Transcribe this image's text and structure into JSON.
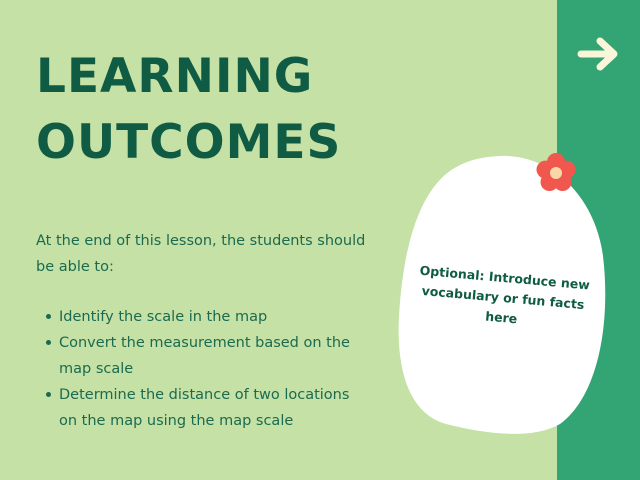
{
  "slide": {
    "title_line1": "LEARNING",
    "title_line2": "OUTCOMES",
    "intro": "At the end of this lesson, the students should be able to:",
    "outcomes": [
      "Identify the scale in the map",
      "Convert the measurement based on the map scale",
      "Determine the distance of two locations on the map using the map scale"
    ],
    "note": "Optional: Introduce new vocabulary or fun facts here"
  },
  "colors": {
    "background": "#c5e1a5",
    "side_band": "#33a474",
    "title": "#0f5b43",
    "body_text": "#1b6a50",
    "note_card": "#ffffff",
    "arrow": "#fbf6d9",
    "flower": "#f0584f",
    "flower_center": "#f9d8a8"
  },
  "icons": {
    "next": "arrow-right-icon",
    "decoration": "flower-icon"
  }
}
